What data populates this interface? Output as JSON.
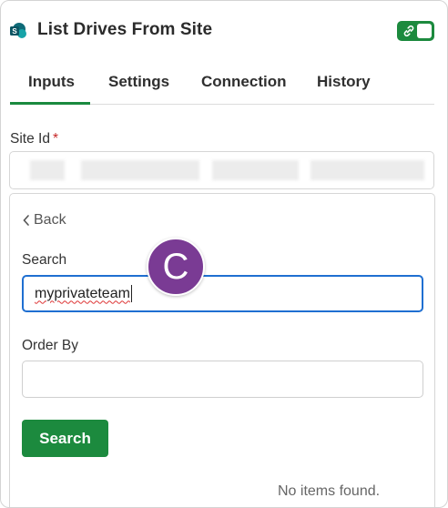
{
  "header": {
    "title": "List Drives From Site",
    "app_icon": "sharepoint-icon",
    "toggle_icon": "link-icon",
    "toggle_state": "on",
    "accent_color": "#1c8a3e"
  },
  "tabs": [
    {
      "label": "Inputs",
      "active": true
    },
    {
      "label": "Settings",
      "active": false
    },
    {
      "label": "Connection",
      "active": false
    },
    {
      "label": "History",
      "active": false
    }
  ],
  "site_id": {
    "label": "Site Id",
    "required_mark": "*",
    "value_redacted": true
  },
  "panel": {
    "back_label": "Back",
    "search_label": "Search",
    "search_value": "myprivateteam",
    "order_by_label": "Order By",
    "order_by_value": "",
    "search_button": "Search",
    "empty_message": "No items found."
  },
  "annotation": {
    "letter": "C",
    "color": "#7a3b94"
  },
  "colors": {
    "focus_border": "#1f6fd1",
    "required": "#c62828"
  }
}
